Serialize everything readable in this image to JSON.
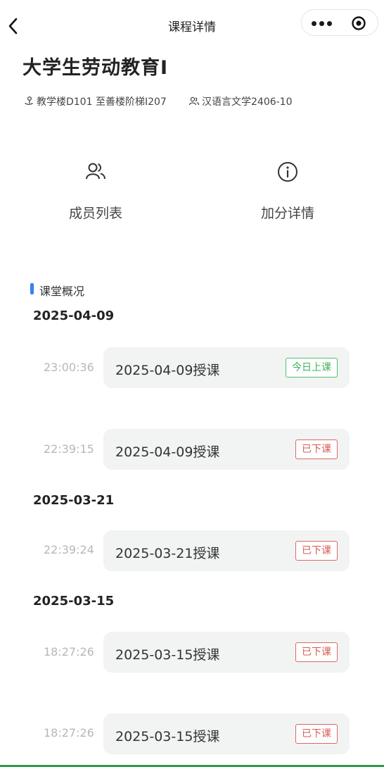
{
  "nav": {
    "title": "课程详情",
    "back_icon": "chevron-left-icon",
    "more_icon": "more-dots-icon",
    "close_icon": "target-circle-icon"
  },
  "course": {
    "title": "大学生劳动教育Ⅰ",
    "location": "教学楼D101 至善楼阶梯I207",
    "class": "汉语言文学2406-10",
    "location_icon": "location-pin-icon",
    "class_icon": "people-icon"
  },
  "actions": [
    {
      "label": "成员列表",
      "icon": "users-icon"
    },
    {
      "label": "加分详情",
      "icon": "info-circle-icon"
    }
  ],
  "section": {
    "title": "课堂概况",
    "accent": "#3a7ef2"
  },
  "days": [
    {
      "date": "2025-04-09",
      "sessions": [
        {
          "time": "23:00:36",
          "title": "2025-04-09授课",
          "status": "今日上课",
          "status_type": "today"
        },
        {
          "time": "22:39:15",
          "title": "2025-04-09授课",
          "status": "已下课",
          "status_type": "done"
        }
      ]
    },
    {
      "date": "2025-03-21",
      "sessions": [
        {
          "time": "22:39:24",
          "title": "2025-03-21授课",
          "status": "已下课",
          "status_type": "done"
        }
      ]
    },
    {
      "date": "2025-03-15",
      "sessions": [
        {
          "time": "18:27:26",
          "title": "2025-03-15授课",
          "status": "已下课",
          "status_type": "done"
        },
        {
          "time": "18:27:26",
          "title": "2025-03-15授课",
          "status": "已下课",
          "status_type": "done"
        }
      ]
    }
  ],
  "colors": {
    "today": "#3cb25c",
    "done": "#d65c55"
  }
}
